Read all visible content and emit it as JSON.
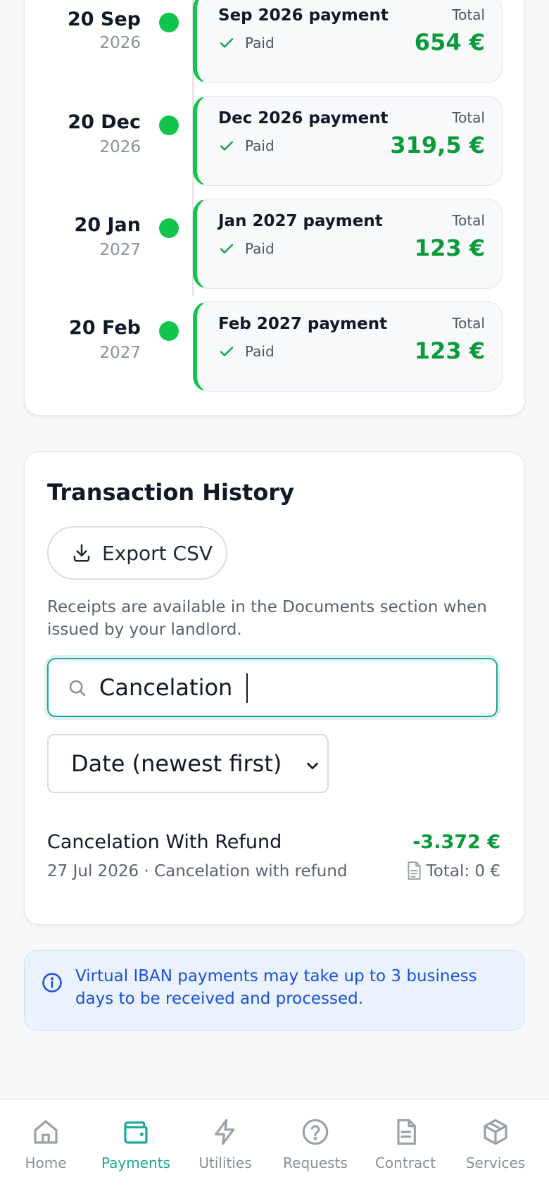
{
  "timeline": {
    "total_label": "Total",
    "payments": [
      {
        "date": "20 Sep",
        "year": "2026",
        "title": "Sep 2026 payment",
        "status": "Paid",
        "amount": "654 €"
      },
      {
        "date": "20 Dec",
        "year": "2026",
        "title": "Dec 2026 payment",
        "status": "Paid",
        "amount": "319,5 €"
      },
      {
        "date": "20 Jan",
        "year": "2027",
        "title": "Jan 2027 payment",
        "status": "Paid",
        "amount": "123 €"
      },
      {
        "date": "20 Feb",
        "year": "2027",
        "title": "Feb 2027 payment",
        "status": "Paid",
        "amount": "123 €"
      }
    ]
  },
  "transactions": {
    "title": "Transaction History",
    "export_label": "Export CSV",
    "note": "Receipts are available in the Documents section when issued by your landlord.",
    "search_value": "Cancelation",
    "sort_selected": "Date (newest first)",
    "items": [
      {
        "name": "Cancelation With Refund",
        "amount": "-3.372 €",
        "meta": "27 Jul 2026 · Cancelation with refund",
        "total": "Total: 0 €"
      }
    ]
  },
  "info": {
    "text": "Virtual IBAN payments may take up to 3 business days to be received and processed."
  },
  "nav": {
    "active": "Payments",
    "items": [
      {
        "label": "Home",
        "icon": "home-icon"
      },
      {
        "label": "Payments",
        "icon": "wallet-icon"
      },
      {
        "label": "Utilities",
        "icon": "bolt-icon"
      },
      {
        "label": "Requests",
        "icon": "question-icon"
      },
      {
        "label": "Contract",
        "icon": "document-icon"
      },
      {
        "label": "Services",
        "icon": "box-icon"
      }
    ]
  },
  "colors": {
    "accent": "#1aa89a",
    "paid_green": "#10c44c",
    "amount_green": "#0b9a3a",
    "info_blue": "#1d4ed8"
  }
}
